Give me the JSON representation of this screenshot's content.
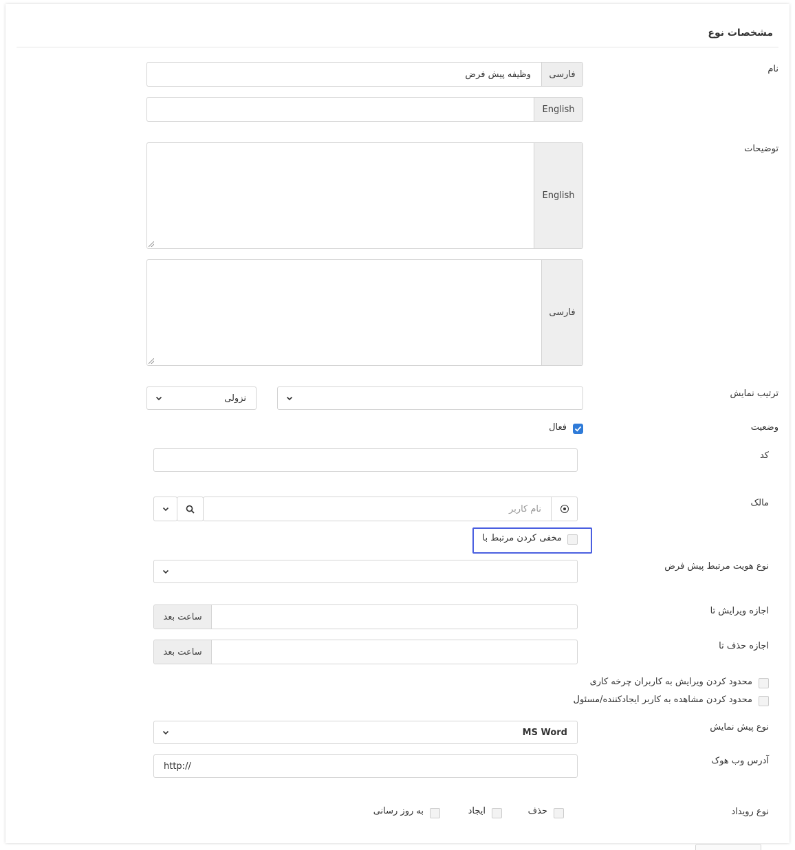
{
  "section": {
    "title": "مشخصات نوع"
  },
  "name": {
    "label": "نام",
    "fa_addon": "فارسی",
    "fa_value": "وظیفه پیش فرض",
    "en_addon": "English",
    "en_value": ""
  },
  "description": {
    "label": "توضیحات",
    "en_addon": "English",
    "fa_addon": "فارسی"
  },
  "display_order": {
    "label": "ترتیب نمایش",
    "field_value": "",
    "direction_value": "نزولی"
  },
  "status": {
    "label": "وضعیت",
    "active_label": "فعال",
    "active_checked": true
  },
  "code": {
    "label": "کد",
    "value": ""
  },
  "owner": {
    "label": "مالک",
    "placeholder": "نام کاربر",
    "hide_related_label": "مخفی کردن مرتبط با"
  },
  "default_related_identity": {
    "label": "نوع هویت مرتبط پیش فرض",
    "value": ""
  },
  "edit_allowed": {
    "label": "اجازه ویرایش تا",
    "addon": "ساعت بعد",
    "value": ""
  },
  "delete_allowed": {
    "label": "اجازه حذف تا",
    "addon": "ساعت بعد",
    "value": ""
  },
  "restrictions": {
    "restrict_edit_label": "محدود کردن ویرایش به کاربران چرخه کاری",
    "restrict_view_label": "محدود کردن مشاهده به کاربر ایجادکننده/مسئول"
  },
  "preview_type": {
    "label": "نوع پیش نمایش",
    "value": "MS Word"
  },
  "webhook": {
    "label": "آدرس وب هوک",
    "value": "http://"
  },
  "event_type": {
    "label": "نوع رویداد",
    "delete_label": "حذف",
    "create_label": "ایجاد",
    "update_label": "به روز رسانی"
  },
  "icons": {
    "chevron": "chevron-down-icon",
    "search": "search-icon",
    "target": "target-icon",
    "check": "check-icon"
  },
  "colors": {
    "checkbox_checked": "#2f7bd8",
    "highlight_border": "#4a5fe0",
    "addon_bg": "#eeeeee"
  }
}
